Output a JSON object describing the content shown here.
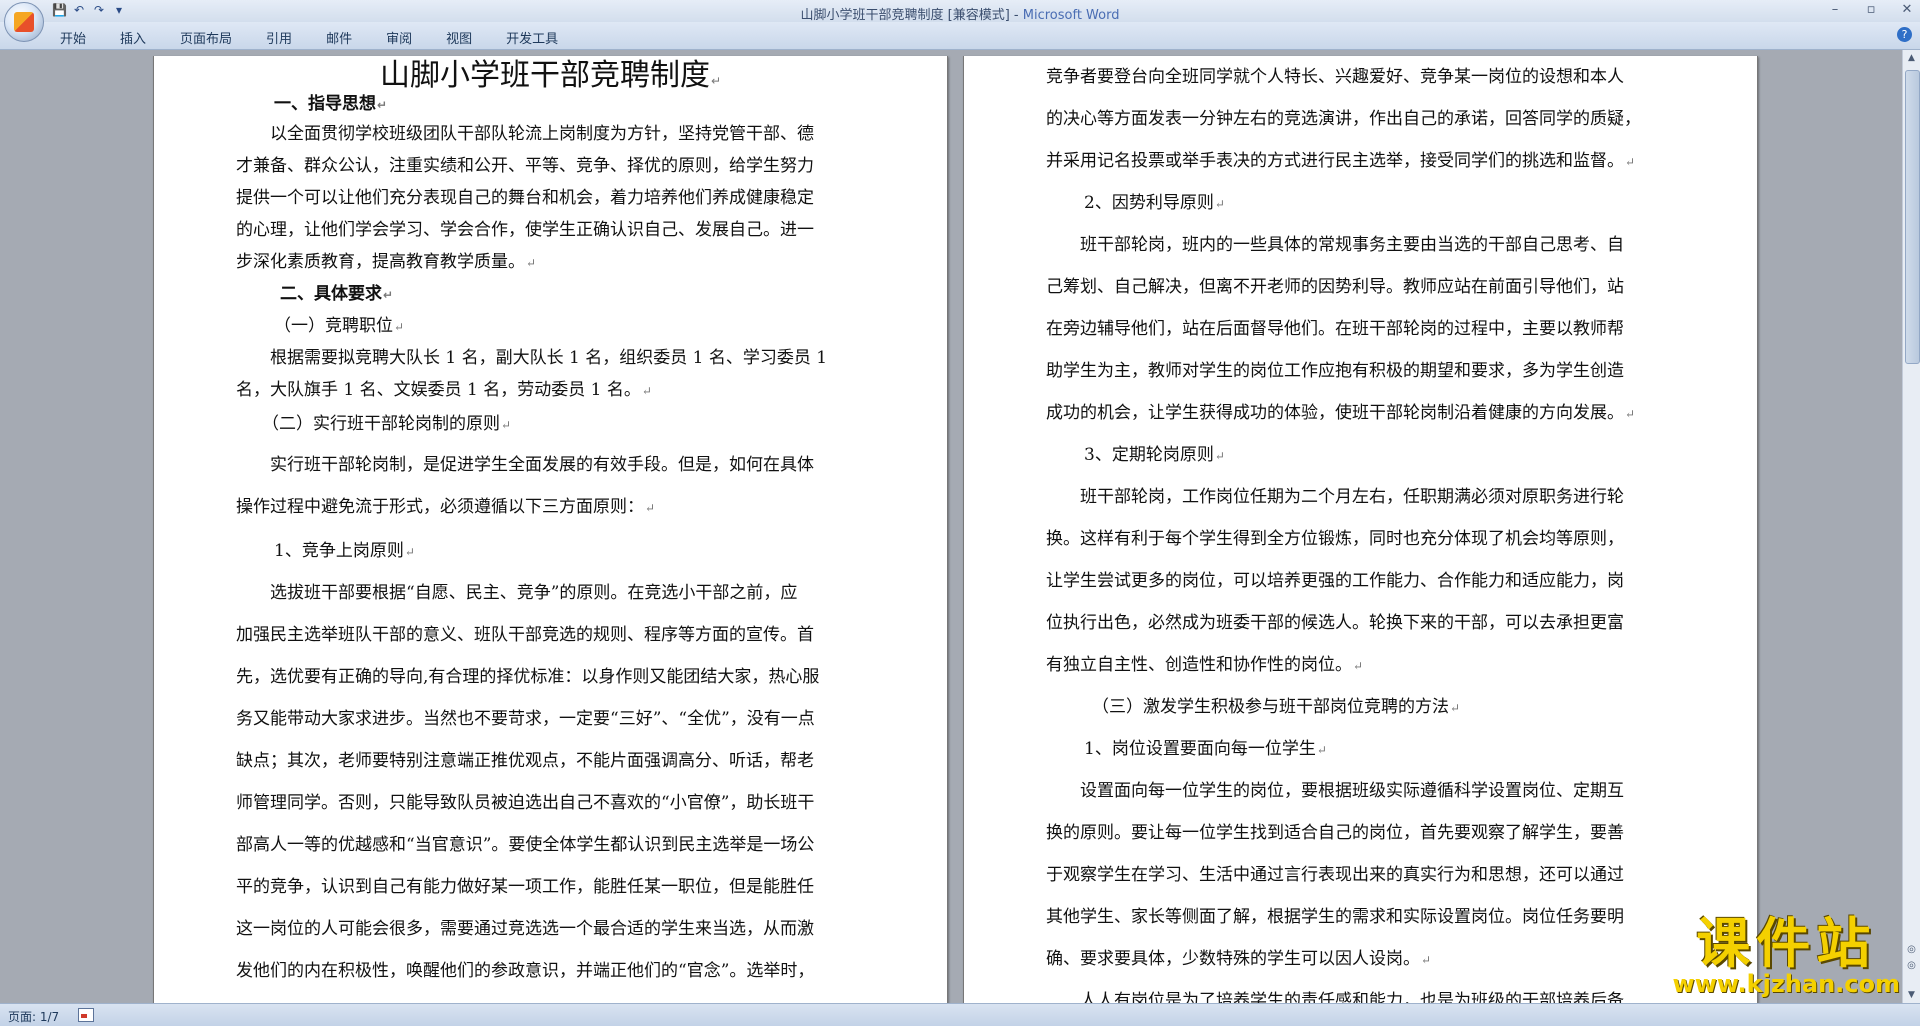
{
  "window": {
    "title_doc": "山脚小学班干部竞聘制度 [兼容模式] - ",
    "title_app": "Microsoft Word"
  },
  "qat": {
    "save": "💾",
    "undo": "↶",
    "redo": "↷",
    "more": "▾"
  },
  "window_controls": {
    "minimize": "–",
    "maximize": "▫",
    "close": "✕"
  },
  "menu": {
    "tabs": [
      "开始",
      "插入",
      "页面布局",
      "引用",
      "邮件",
      "审阅",
      "视图",
      "开发工具"
    ],
    "help": "?"
  },
  "doc": {
    "title": "山脚小学班干部竞聘制度",
    "left": {
      "h1": "一、指导思想",
      "p1": [
        "　　以全面贯彻学校班级团队干部队轮流上岗制度为方针，坚持党管干部、德",
        "才兼备、群众公认，注重实绩和公开、平等、竞争、择优的原则，给学生努力",
        "提供一个可以让他们充分表现自己的舞台和机会，着力培养他们养成健康稳定",
        "的心理，让他们学会学习、学会合作，使学生正确认识自己、发展自己。进一",
        "步深化素质教育，提高教育教学质量。"
      ],
      "h2": "二、具体要求",
      "h2a": "（一）竞聘职位",
      "p2": [
        "　　根据需要拟竞聘大队长 1 名，副大队长 1 名，组织委员 1 名、学习委员 1",
        "名，大队旗手 1 名、文娱委员 1 名，劳动委员 1 名。"
      ],
      "h2b": "（二）实行班干部轮岗制的原则",
      "p3": [
        "　　实行班干部轮岗制，是促进学生全面发展的有效手段。但是，如何在具体",
        "操作过程中避免流于形式，必须遵循以下三方面原则："
      ],
      "h3": "1、竞争上岗原则",
      "p4": [
        "　　选拔班干部要根据“自愿、民主、竞争”的原则。在竞选小干部之前，应",
        "加强民主选举班队干部的意义、班队干部竞选的规则、程序等方面的宣传。首",
        "先，选优要有正确的导向,有合理的择优标准：以身作则又能团结大家，热心服",
        "务又能带动大家求进步。当然也不要苛求，一定要“三好”、“全优”，没有一点",
        "缺点；其次，老师要特别注意端正推优观点，不能片面强调高分、听话，帮老",
        "师管理同学。否则，只能导致队员被迫选出自己不喜欢的“小官僚”，助长班干",
        "部高人一等的优越感和“当官意识”。要使全体学生都认识到民主选举是一场公",
        "平的竞争，认识到自己有能力做好某一项工作，能胜任某一职位，但是能胜任",
        "这一岗位的人可能会很多，需要通过竞选选一个最合适的学生来当选，从而激",
        "发他们的内在积极性，唤醒他们的参政意识，并端正他们的“官念”。选举时，"
      ]
    },
    "right": {
      "p1": [
        "竞争者要登台向全班同学就个人特长、兴趣爱好、竞争某一岗位的设想和本人",
        "的决心等方面发表一分钟左右的竞选演讲，作出自己的承诺，回答同学的质疑，",
        "并采用记名投票或举手表决的方式进行民主选举，接受同学们的挑选和监督。"
      ],
      "h2": "2、因势利导原则",
      "p2": [
        "　　班干部轮岗，班内的一些具体的常规事务主要由当选的干部自己思考、自",
        "己筹划、自己解决，但离不开老师的因势利导。教师应站在前面引导他们，站",
        "在旁边辅导他们，站在后面督导他们。在班干部轮岗的过程中，主要以教师帮",
        "助学生为主，教师对学生的岗位工作应抱有积极的期望和要求，多为学生创造",
        "成功的机会，让学生获得成功的体验，使班干部轮岗制沿着健康的方向发展。"
      ],
      "h3": "3、定期轮岗原则",
      "p3": [
        "　　班干部轮岗，工作岗位任期为二个月左右，任职期满必须对原职务进行轮",
        "换。这样有利于每个学生得到全方位锻炼，同时也充分体现了机会均等原则，",
        "让学生尝试更多的岗位，可以培养更强的工作能力、合作能力和适应能力，岗",
        "位执行出色，必然成为班委干部的候选人。轮换下来的干部，可以去承担更富",
        "有独立自主性、创造性和协作性的岗位。"
      ],
      "h4": "（三）激发学生积极参与班干部岗位竞聘的方法",
      "h5": "1、岗位设置要面向每一位学生",
      "p4": [
        "　　设置面向每一位学生的岗位，要根据班级实际遵循科学设置岗位、定期互",
        "换的原则。要让每一位学生找到适合自己的岗位，首先要观察了解学生，要善",
        "于观察学生在学习、生活中通过言行表现出来的真实行为和思想，还可以通过",
        "其他学生、家长等侧面了解，根据学生的需求和实际设置岗位。岗位任务要明",
        "确、要求要具体，少数特殊的学生可以因人设岗。"
      ],
      "p5": "　　人人有岗位是为了培养学生的责任感和能力，也是为班级的干部培养后备"
    }
  },
  "paragraph_mark": "↵",
  "scrollbar": {
    "up": "▲",
    "down": "▼",
    "prev": "◎",
    "next": "◎"
  },
  "status": {
    "page": "页面: 1/7"
  },
  "watermark": {
    "text": "课件站",
    "url": "www.kjzhan.com"
  }
}
